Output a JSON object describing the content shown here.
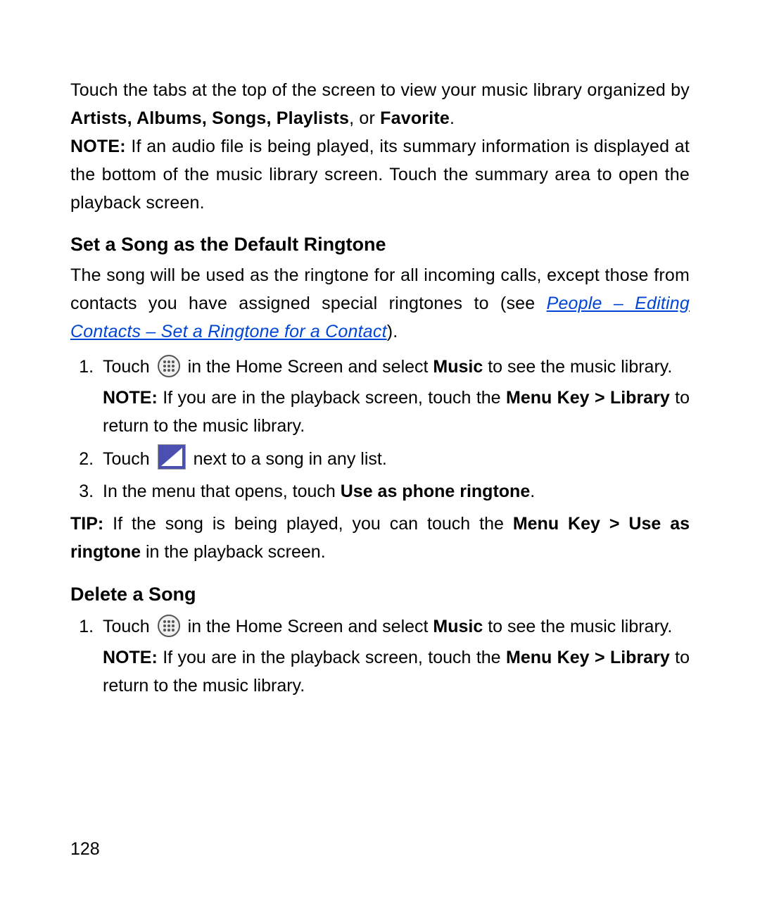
{
  "intro": {
    "pre_bold": "Touch the tabs at the top of the screen to view your music library organized by ",
    "tabs_bold": "Artists, Albums, Songs, Playlists",
    "mid": ", or ",
    "fav_bold": "Favorite",
    "end": "."
  },
  "note1": {
    "label": "NOTE:",
    "text": " If an audio file is being played, its summary information is displayed at the bottom of the music library screen. Touch the summary area to open the playback screen."
  },
  "ringtone": {
    "heading": "Set a Song as the Default Ringtone",
    "para_pre": "The song will be used as the ringtone for all incoming calls, except those from contacts you have assigned special ringtones to (see ",
    "link": "People – Editing Contacts – Set a Ringtone for a Contact",
    "para_post": ").",
    "step1_a": "Touch ",
    "step1_b": " in the Home Screen and select ",
    "step1_music": "Music",
    "step1_c": " to see the music library.",
    "step1_note_label": "NOTE:",
    "step1_note_a": " If you are in the playback screen, touch the ",
    "step1_note_menu": "Menu Key > Library",
    "step1_note_b": " to return to the music library.",
    "step2_a": "Touch ",
    "step2_b": " next to a song in any list.",
    "step3_a": "In the menu that opens, touch ",
    "step3_b": "Use as phone ringtone",
    "step3_c": ".",
    "tip_label": "TIP:",
    "tip_a": " If the song is being played, you can touch the ",
    "tip_menu": "Menu Key > Use as ringtone",
    "tip_b": " in the playback screen."
  },
  "delete": {
    "heading": "Delete a Song",
    "step1_a": "Touch ",
    "step1_b": " in the Home Screen and select ",
    "step1_music": "Music",
    "step1_c": " to see the music library.",
    "step1_note_label": "NOTE:",
    "step1_note_a": " If you are in the playback screen, touch the ",
    "step1_note_menu": "Menu Key > Library",
    "step1_note_b": " to return to the music library."
  },
  "page_number": "128"
}
